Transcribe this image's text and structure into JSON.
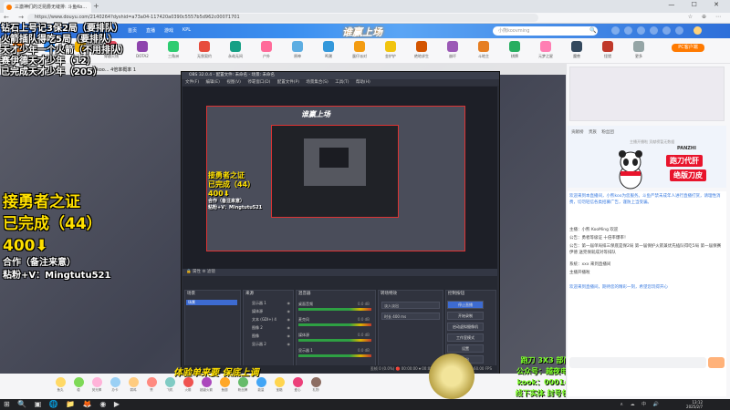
{
  "browser": {
    "tab_title": "三激神们的泛昆爵无缝排: 斗鱼Ko...",
    "new_tab": "+",
    "window_controls": "— ☐ ✕",
    "url": "https://www.douyu.com/2140264?dyshid=a73a04-117420a0390c5557b5d962c00071701",
    "nav": "← → ⟳",
    "tools": "☆ ⊕ ⋯"
  },
  "site": {
    "logo": "斗鱼",
    "nav_items": [
      "首页",
      "直播",
      "游戏",
      "KPL"
    ],
    "banner": "谁赢上场",
    "search_placeholder": "小熊koovming",
    "search_icon": "search-icon",
    "pc_button": "PC客户端"
  },
  "game_bar": {
    "items": [
      "王者荣耀",
      "英雄联盟",
      "和平精英",
      "穿越火线",
      "DOTA2",
      "三角洲",
      "无畏契约",
      "永劫无间",
      "户外",
      "原神",
      "鸣潮",
      "蛋仔派对",
      "金铲铲",
      "绝地求生",
      "崩坏",
      "斗地主",
      "棋牌",
      "元梦之星",
      "魔兽",
      "怪猎",
      "更多"
    ]
  },
  "stream": {
    "title": "小熊koo... 4倍率概率 1"
  },
  "overlay": {
    "lines": [
      "钻石上号记3保2局（要排队）",
      "火箭插队得吃5局（要排队）",
      "天才少年一个火箭（不用排队）",
      "赛伊德天才少年（12）",
      "已完成天才少年（205）"
    ]
  },
  "big_overlay": {
    "line1": "接勇者之证",
    "line2": "已完成（44）",
    "line3": "400⬇",
    "line4": "合作（备注来意）",
    "line5": "粘粉+V：Mingtutu521"
  },
  "obs": {
    "title": "OBS 32.0.4 - 配置文件: 未命名 - 场景: 未命名",
    "menu": "文件(F) 编辑(E) 视图(V) 停靠窗口(D) 配置文件(P) 场景集合(S) 工具(T) 帮助(H)",
    "capture_text": [
      "接勇者之证",
      "已完成（44）",
      "400⬇"
    ],
    "capture_subtext": [
      "合作（备注来意）",
      "粘粉+V：Mingtutu521"
    ],
    "capture_logo": "谁赢上场",
    "preview_bar": "🔒 属性   ⚙ 滤镜",
    "docks": {
      "scenes": "场景",
      "sources": "来源",
      "mixer": "混音器",
      "transitions": "转场特效",
      "controls": "控制按钮"
    },
    "scene_items": [
      "场景"
    ],
    "source_items": [
      "显示器 1",
      "媒体源",
      "文本 (GDI+) 4",
      "图像 2",
      "图像",
      "显示器 2"
    ],
    "mixer_items": [
      "桌面音频",
      "麦克风",
      "媒体源",
      "显示器 1"
    ],
    "mixer_db": [
      "0.0 dB",
      "0.0 dB",
      "0.0 dB",
      "0.0 dB"
    ],
    "transition_values": [
      "淡入淡出",
      "时长 400 ms"
    ],
    "control_buttons": [
      "停止直播",
      "开始录制",
      "启动虚拟摄像机",
      "工作室模式",
      "设置",
      "退出"
    ],
    "status": "丢帧 0 (0.0%)   🔴 00:00:00   ⏺ 00:00:00   CPU: 0.7%   60.00 / 60.00 FPS"
  },
  "slogan": "体验单来要 保底上调",
  "promo": {
    "line1": "跑刀 3X3 部门",
    "line2": "公众号：越夜电竞",
    "line3": "kook：000147",
    "line4": "线下实体 封号包赔"
  },
  "gifts": [
    "鱼丸",
    "稳",
    "荧光棒",
    "办卡",
    "弱鸡",
    "赞",
    "飞机",
    "火箭",
    "超级火箭",
    "鱼翅",
    "粉丝牌",
    "能量",
    "宝箱",
    "爱心",
    "礼物"
  ],
  "right_panel": {
    "rank_tabs": [
      "贡献榜",
      "贵族",
      "粉丝团"
    ],
    "rank_notice": "主播开播啦 贡献榜暂无数据",
    "panzhi_name": "PANZHI",
    "panzhi_tag1": "跑刀代肝",
    "panzhi_tag2": "绝版刀皮",
    "notice": "欢迎来到本直播间，小熊koo为您服务。斗鱼严禁未成年人进行直播打赏，请理性消费，切勿轻信各类招募广告，谨防上当受骗。",
    "messages": [
      "主播：小熊 KooMing 欢迎",
      "公告：勇者等级证 十倍率爆率！",
      "公告：第一届单局排三保底是保2局 第一届保护火箭兼优先插队得吃5局 第一届保赛伊德 送完保就成对等排队",
      "系统：xxx 来到直播间",
      "主播开播啦"
    ],
    "welcome": "欢迎来到直播间，期待您的精彩一刻，希望您玩得开心"
  },
  "taskbar": {
    "icons": "⊞ 🔍 ▣ 🌐 📁 🦊 ◉ ▶",
    "tray": "∧ ☁ 中 🔊",
    "time": "13:12",
    "date": "2025/2/7"
  }
}
